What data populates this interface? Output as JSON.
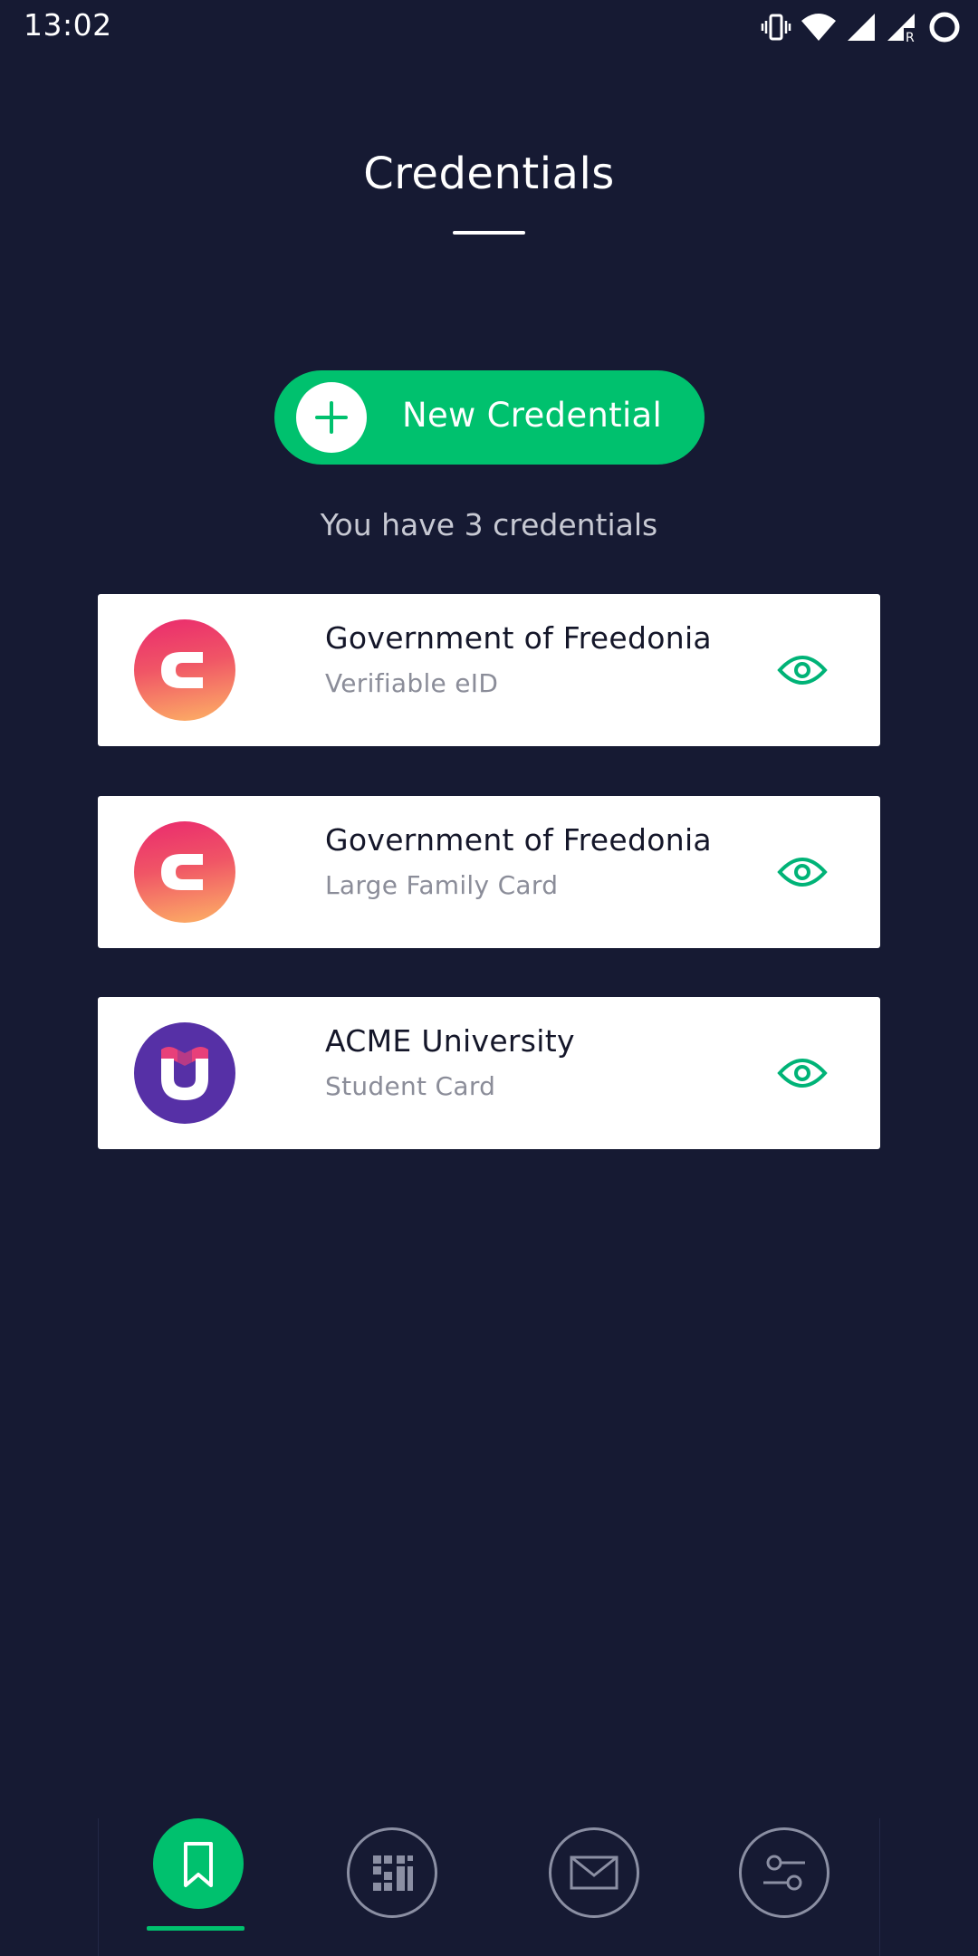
{
  "status_bar": {
    "time": "13:02",
    "icons": [
      "vibrate-icon",
      "wifi-icon",
      "signal-icon",
      "signal-roaming-icon",
      "battery-icon"
    ]
  },
  "header": {
    "title": "Credentials"
  },
  "actions": {
    "new_credential_label": "New Credential"
  },
  "summary": {
    "count_text": "You have 3 credentials"
  },
  "credentials": [
    {
      "issuer": "Government of Freedonia",
      "type": "Verifiable eID",
      "logo": "freedonia-logo"
    },
    {
      "issuer": "Government of Freedonia",
      "type": "Large Family Card",
      "logo": "freedonia-logo"
    },
    {
      "issuer": "ACME University",
      "type": "Student Card",
      "logo": "acme-university-logo"
    }
  ],
  "bottom_nav": {
    "items": [
      {
        "icon": "bookmark-icon",
        "active": true
      },
      {
        "icon": "qr-scan-icon",
        "active": false
      },
      {
        "icon": "mail-icon",
        "active": false
      },
      {
        "icon": "settings-sliders-icon",
        "active": false
      }
    ]
  },
  "colors": {
    "background": "#161a33",
    "accent": "#00c16e",
    "card": "#ffffff",
    "muted_text": "#8b8d99"
  }
}
